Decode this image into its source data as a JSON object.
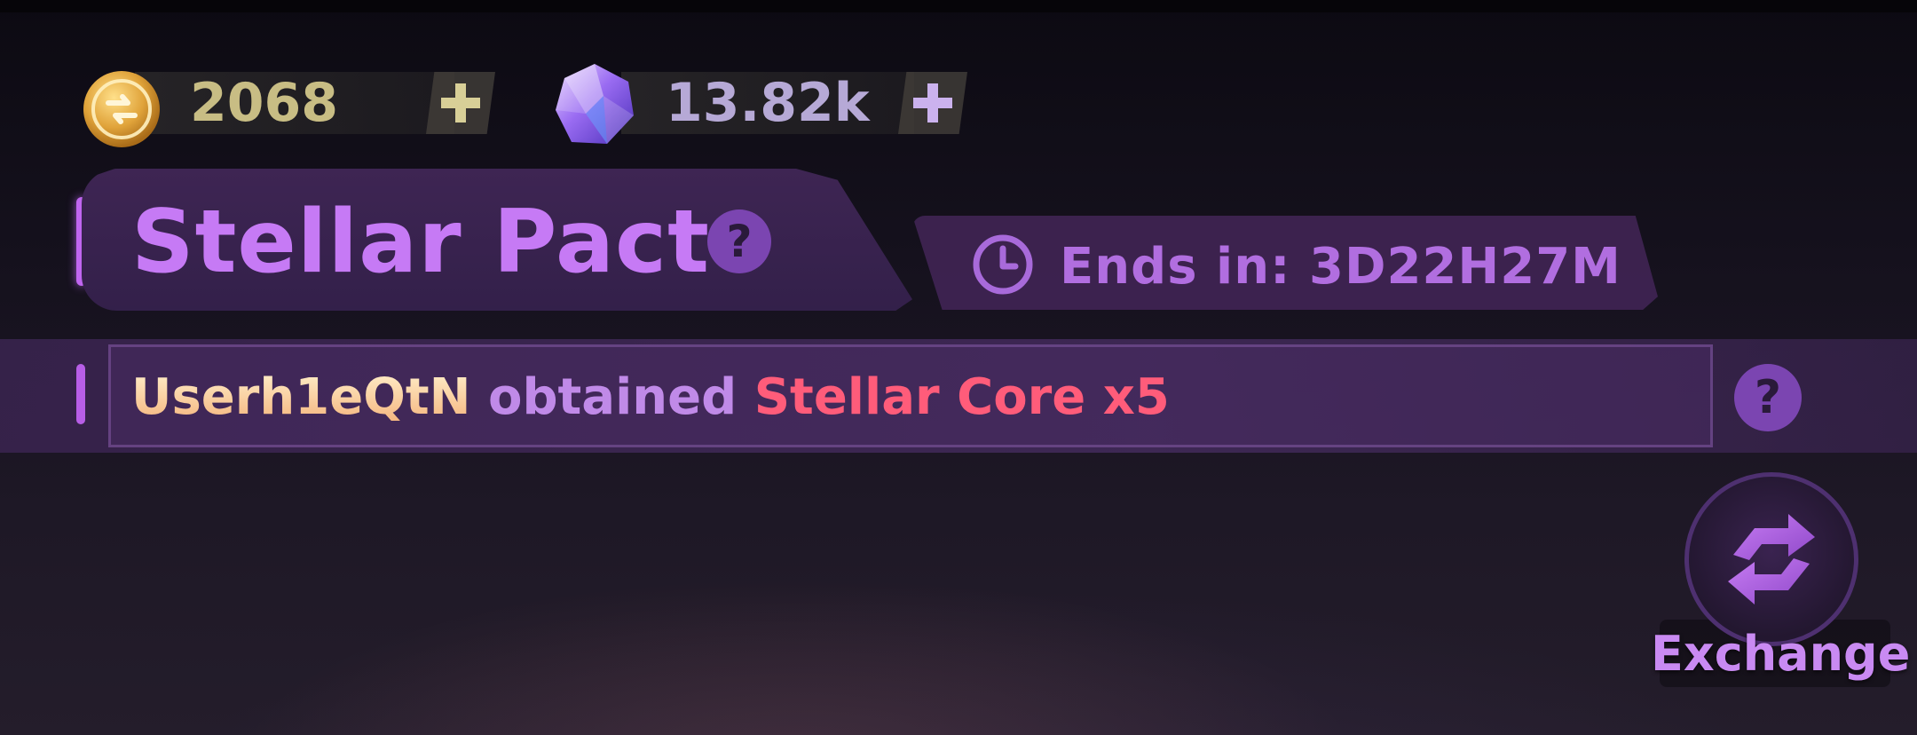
{
  "currencies": {
    "coin": {
      "value": "2068",
      "color": "#c8bd84"
    },
    "gem": {
      "value": "13.82k",
      "color": "#b6a9d6"
    }
  },
  "header": {
    "title": "Stellar Pact",
    "help_symbol": "?",
    "timer": "Ends in: 3D22H27M"
  },
  "announcement": {
    "user": "Userh1eQtN",
    "verb": "obtained",
    "item": "Stellar Core x5",
    "user_color": "#ffd9a0",
    "verb_color": "#c08ae8",
    "item_color": "#ff5c7a"
  },
  "exchange": {
    "label": "Exchange"
  },
  "icons": [
    "coin-icon",
    "gem-icon",
    "plus-icon",
    "help-icon",
    "clock-icon",
    "exchange-icon"
  ]
}
